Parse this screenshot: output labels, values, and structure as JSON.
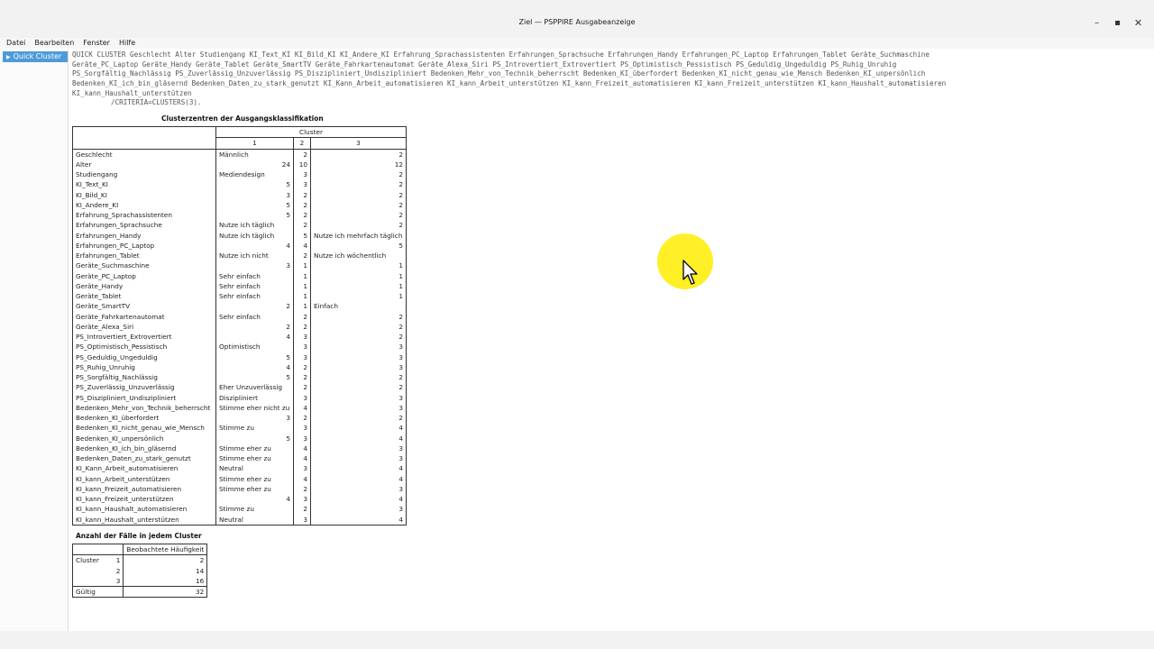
{
  "window": {
    "title": "Ziel — PSPPIRE Ausgabeanzeige",
    "controls": {
      "minimize": "–",
      "maximize": "▪",
      "close": "✕"
    }
  },
  "menu": [
    "Datei",
    "Bearbeiten",
    "Fenster",
    "Hilfe"
  ],
  "sidebar": {
    "items": [
      {
        "label": "Quick Cluster",
        "icon": "triangle-right-icon"
      }
    ]
  },
  "syntax": {
    "lines": [
      "QUICK CLUSTER  Geschlecht Alter Studiengang KI_Text_KI KI_Bild_KI KI_Andere_KI Erfahrung_Sprachassistenten Erfahrungen_Sprachsuche Erfahrungen_Handy Erfahrungen_PC_Laptop Erfahrungen_Tablet Geräte_Suchmaschine",
      "Geräte_PC_Laptop Geräte_Handy Geräte_Tablet Geräte_SmartTV Geräte_Fahrkartenautomat Geräte_Alexa_Siri PS_Introvertiert_Extrovertiert PS_Optimistisch_Pessistisch PS_Geduldig_Ungeduldig PS_Ruhig_Unruhig",
      "PS_Sorgfältig_Nachlässig PS_Zuverlässig_Unzuverlässig PS_Diszipliniert_Undiszipliniert Bedenken_Mehr_von_Technik_beherrscht Bedenken_KI_überfordert Bedenken_KI_nicht_genau_wie_Mensch Bedenken_KI_unpersönlich",
      "Bedenken_KI_ich_bin_gläsernd Bedenken_Daten_zu_stark_genutzt KI_Kann_Arbeit_automatisieren KI_kann_Arbeit_unterstützen KI_kann_Freizeit_automatisieren KI_kann_Freizeit_unterstützen KI_kann_Haushalt_automatisieren",
      "KI_kann_Haushalt_unterstützen"
    ],
    "criteria": "/CRITERIA=CLUSTERS(3)."
  },
  "cluster_table": {
    "title": "Clusterzentren der Ausgangsklassifikation",
    "group_header": "Cluster",
    "columns": [
      "1",
      "2",
      "3"
    ],
    "rows": [
      {
        "label": "Geschlecht",
        "v": [
          "Männlich",
          "2",
          "2"
        ]
      },
      {
        "label": "Alter",
        "v": [
          "24",
          "10",
          "12"
        ]
      },
      {
        "label": "Studiengang",
        "v": [
          "Mediendesign",
          "3",
          "2"
        ]
      },
      {
        "label": "KI_Text_KI",
        "v": [
          "5",
          "3",
          "2"
        ]
      },
      {
        "label": "KI_Bild_KI",
        "v": [
          "3",
          "2",
          "2"
        ]
      },
      {
        "label": "KI_Andere_KI",
        "v": [
          "5",
          "2",
          "2"
        ]
      },
      {
        "label": "Erfahrung_Sprachassistenten",
        "v": [
          "5",
          "2",
          "2"
        ]
      },
      {
        "label": "Erfahrungen_Sprachsuche",
        "v": [
          "Nutze ich täglich",
          "2",
          "2"
        ]
      },
      {
        "label": "Erfahrungen_Handy",
        "v": [
          "Nutze ich täglich",
          "5",
          "Nutze ich mehrfach täglich"
        ]
      },
      {
        "label": "Erfahrungen_PC_Laptop",
        "v": [
          "4",
          "4",
          "5"
        ]
      },
      {
        "label": "Erfahrungen_Tablet",
        "v": [
          "Nutze ich nicht",
          "2",
          "Nutze ich wöchentlich"
        ]
      },
      {
        "label": "Geräte_Suchmaschine",
        "v": [
          "3",
          "1",
          "1"
        ]
      },
      {
        "label": "Geräte_PC_Laptop",
        "v": [
          "Sehr einfach",
          "1",
          "1"
        ]
      },
      {
        "label": "Geräte_Handy",
        "v": [
          "Sehr einfach",
          "1",
          "1"
        ]
      },
      {
        "label": "Geräte_Tablet",
        "v": [
          "Sehr einfach",
          "1",
          "1"
        ]
      },
      {
        "label": "Geräte_SmartTV",
        "v": [
          "2",
          "1",
          "Einfach"
        ]
      },
      {
        "label": "Geräte_Fahrkartenautomat",
        "v": [
          "Sehr einfach",
          "2",
          "2"
        ]
      },
      {
        "label": "Geräte_Alexa_Siri",
        "v": [
          "2",
          "2",
          "2"
        ]
      },
      {
        "label": "PS_Introvertiert_Extrovertiert",
        "v": [
          "4",
          "3",
          "2"
        ]
      },
      {
        "label": "PS_Optimistisch_Pessistisch",
        "v": [
          "Optimistisch",
          "3",
          "3"
        ]
      },
      {
        "label": "PS_Geduldig_Ungeduldig",
        "v": [
          "5",
          "3",
          "3"
        ]
      },
      {
        "label": "PS_Ruhig_Unruhig",
        "v": [
          "4",
          "2",
          "3"
        ]
      },
      {
        "label": "PS_Sorgfältig_Nachlässig",
        "v": [
          "5",
          "2",
          "2"
        ]
      },
      {
        "label": "PS_Zuverlässig_Unzuverlässig",
        "v": [
          "Eher Unzuverlässig",
          "2",
          "2"
        ]
      },
      {
        "label": "PS_Diszipliniert_Undiszipliniert",
        "v": [
          "Diszipliniert",
          "3",
          "3"
        ]
      },
      {
        "label": "Bedenken_Mehr_von_Technik_beherrscht",
        "v": [
          "Stimme eher nicht zu",
          "4",
          "3"
        ]
      },
      {
        "label": "Bedenken_KI_überfordert",
        "v": [
          "3",
          "2",
          "2"
        ]
      },
      {
        "label": "Bedenken_KI_nicht_genau_wie_Mensch",
        "v": [
          "Stimme zu",
          "3",
          "4"
        ]
      },
      {
        "label": "Bedenken_KI_unpersönlich",
        "v": [
          "5",
          "3",
          "4"
        ]
      },
      {
        "label": "Bedenken_KI_ich_bin_gläsernd",
        "v": [
          "Stimme eher zu",
          "4",
          "3"
        ]
      },
      {
        "label": "Bedenken_Daten_zu_stark_genutzt",
        "v": [
          "Stimme eher zu",
          "4",
          "3"
        ]
      },
      {
        "label": "KI_Kann_Arbeit_automatisieren",
        "v": [
          "Neutral",
          "3",
          "4"
        ]
      },
      {
        "label": "KI_kann_Arbeit_unterstützen",
        "v": [
          "Stimme eher zu",
          "4",
          "4"
        ]
      },
      {
        "label": "KI_kann_Freizeit_automatisieren",
        "v": [
          "Stimme eher zu",
          "2",
          "3"
        ]
      },
      {
        "label": "KI_kann_Freizeit_unterstützen",
        "v": [
          "4",
          "3",
          "4"
        ]
      },
      {
        "label": "KI_kann_Haushalt_automatisieren",
        "v": [
          "Stimme zu",
          "2",
          "3"
        ]
      },
      {
        "label": "KI_kann_Haushalt_unterstützen",
        "v": [
          "Neutral",
          "3",
          "4"
        ]
      }
    ]
  },
  "count_table": {
    "title": "Anzahl der Fälle in jedem Cluster",
    "header": "Beobachtete Häufigkeit",
    "group_label": "Cluster",
    "rows": [
      {
        "cluster": "1",
        "value": "2"
      },
      {
        "cluster": "2",
        "value": "14"
      },
      {
        "cluster": "3",
        "value": "16"
      }
    ],
    "total_label": "Gültig",
    "total_value": "32"
  }
}
